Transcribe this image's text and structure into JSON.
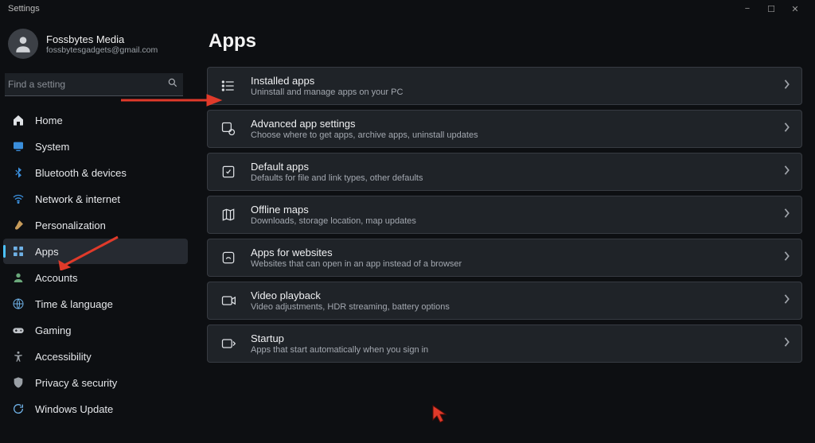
{
  "window": {
    "title": "Settings"
  },
  "profile": {
    "name": "Fossbytes Media",
    "email": "fossbytesgadgets@gmail.com"
  },
  "search": {
    "placeholder": "Find a setting"
  },
  "sidebar": {
    "items": [
      {
        "label": "Home"
      },
      {
        "label": "System"
      },
      {
        "label": "Bluetooth & devices"
      },
      {
        "label": "Network & internet"
      },
      {
        "label": "Personalization"
      },
      {
        "label": "Apps"
      },
      {
        "label": "Accounts"
      },
      {
        "label": "Time & language"
      },
      {
        "label": "Gaming"
      },
      {
        "label": "Accessibility"
      },
      {
        "label": "Privacy & security"
      },
      {
        "label": "Windows Update"
      }
    ],
    "selected_index": 5
  },
  "page": {
    "title": "Apps",
    "items": [
      {
        "title": "Installed apps",
        "desc": "Uninstall and manage apps on your PC"
      },
      {
        "title": "Advanced app settings",
        "desc": "Choose where to get apps, archive apps, uninstall updates"
      },
      {
        "title": "Default apps",
        "desc": "Defaults for file and link types, other defaults"
      },
      {
        "title": "Offline maps",
        "desc": "Downloads, storage location, map updates"
      },
      {
        "title": "Apps for websites",
        "desc": "Websites that can open in an app instead of a browser"
      },
      {
        "title": "Video playback",
        "desc": "Video adjustments, HDR streaming, battery options"
      },
      {
        "title": "Startup",
        "desc": "Apps that start automatically when you sign in"
      }
    ]
  },
  "colors": {
    "accent": "#4cc2ff",
    "annotation": "#e03a2a"
  }
}
